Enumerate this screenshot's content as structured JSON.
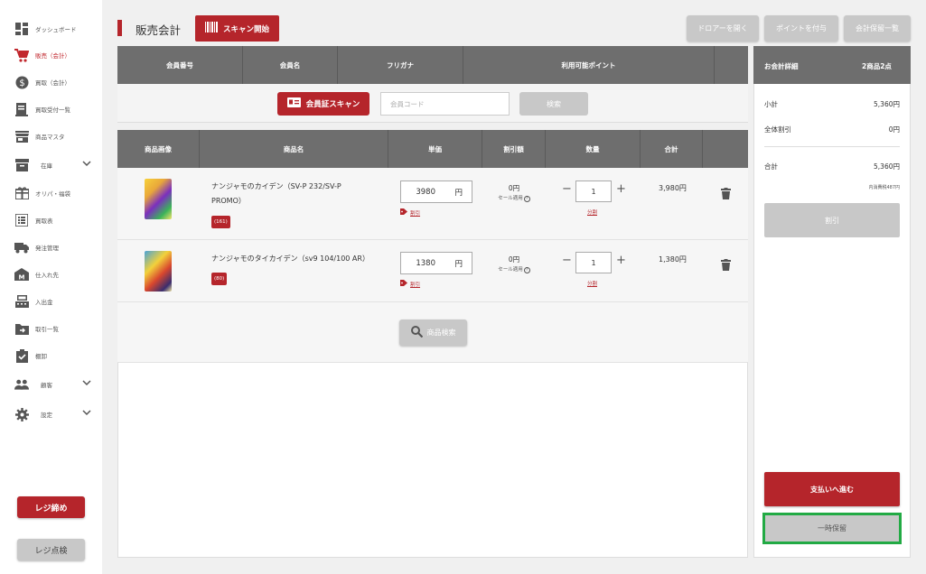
{
  "sidebar": {
    "items": [
      {
        "label": "ダッシュボード",
        "icon": "dashboard-icon"
      },
      {
        "label": "販売（会計）",
        "icon": "cart-icon",
        "active": true
      },
      {
        "label": "買取（会計）",
        "icon": "dollar-icon"
      },
      {
        "label": "買取受付一覧",
        "icon": "receipt-icon"
      },
      {
        "label": "商品マスタ",
        "icon": "store-icon"
      },
      {
        "label": "在庫",
        "icon": "archive-icon"
      },
      {
        "label": "オリパ・福袋",
        "icon": "gift-icon"
      },
      {
        "label": "買取表",
        "icon": "list-icon"
      },
      {
        "label": "発注管理",
        "icon": "truck-icon"
      },
      {
        "label": "仕入れ先",
        "icon": "factory-icon"
      },
      {
        "label": "入出金",
        "icon": "register-icon"
      },
      {
        "label": "取引一覧",
        "icon": "folder-arrow-icon"
      },
      {
        "label": "棚卸",
        "icon": "clipboard-check-icon"
      },
      {
        "label": "顧客",
        "icon": "people-icon"
      },
      {
        "label": "設定",
        "icon": "gear-icon"
      }
    ],
    "close_register": "レジ締め",
    "check_register": "レジ点検"
  },
  "header": {
    "title": "販売会計",
    "scan_button": "スキャン開始",
    "drawer_button": "ドロアーを開く",
    "points_button": "ポイントを付与",
    "saved_list_button": "会計保留一覧"
  },
  "member": {
    "columns": [
      "会員番号",
      "会員名",
      "フリガナ",
      "利用可能ポイント"
    ],
    "scan_button": "会員証スキャン",
    "code_placeholder": "会員コード",
    "search_button": "検索"
  },
  "items": {
    "columns": [
      "商品画像",
      "商品名",
      "単価",
      "割引額",
      "数量",
      "合計"
    ],
    "rows": [
      {
        "name": "ナンジャモのカイデン（SV-P 232/SV-P PROMO）",
        "badge": "(161)",
        "price": "3980",
        "yen": "円",
        "discount_link": "割引",
        "discount": "0円",
        "discount_note": "セール適用",
        "qty": "1",
        "split_link": "分割",
        "total": "3,980円"
      },
      {
        "name": "ナンジャモのタイカイデン（sv9 104/100 AR）",
        "badge": "(80)",
        "price": "1380",
        "yen": "円",
        "discount_link": "割引",
        "discount": "0円",
        "discount_note": "セール適用",
        "qty": "1",
        "split_link": "分割",
        "total": "1,380円"
      }
    ],
    "product_search_button": "商品検索"
  },
  "summary": {
    "title": "お会計詳細",
    "count": "2商品2点",
    "subtotal_label": "小計",
    "subtotal": "5,360円",
    "overall_discount_label": "全体割引",
    "overall_discount": "0円",
    "total_label": "合計",
    "total": "5,360円",
    "tax_note": "内消費税487円",
    "discount_button": "割引",
    "pay_button": "支払いへ進む",
    "hold_button": "一時保留"
  },
  "colors": {
    "accent": "#b5252b",
    "header_gray": "#6e6e6e",
    "highlight": "#22aa44"
  }
}
